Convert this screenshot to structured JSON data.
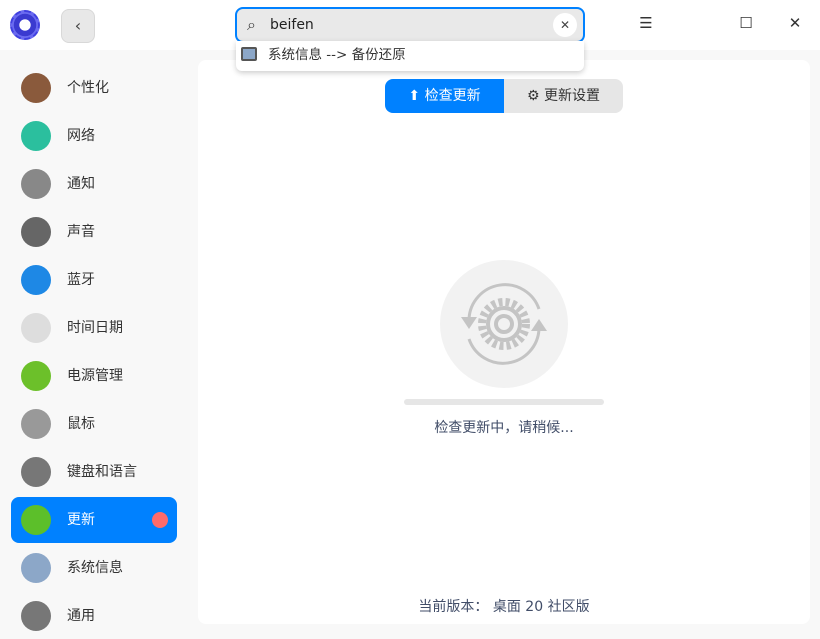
{
  "search": {
    "value": "beifen",
    "suggestion": "系统信息 --> 备份还原"
  },
  "sidebar": {
    "items": [
      {
        "label": "个性化",
        "color": "#8a5a3c"
      },
      {
        "label": "网络",
        "color": "#2bbf9e"
      },
      {
        "label": "通知",
        "color": "#888888"
      },
      {
        "label": "声音",
        "color": "#666666"
      },
      {
        "label": "蓝牙",
        "color": "#1e88e5"
      },
      {
        "label": "时间日期",
        "color": "#dddddd"
      },
      {
        "label": "电源管理",
        "color": "#6cc02a"
      },
      {
        "label": "鼠标",
        "color": "#999999"
      },
      {
        "label": "键盘和语言",
        "color": "#777777"
      },
      {
        "label": "更新",
        "color": "#5cbf2a"
      },
      {
        "label": "系统信息",
        "color": "#8ca7c8"
      },
      {
        "label": "通用",
        "color": "#777777"
      }
    ]
  },
  "main": {
    "tabs": [
      "检查更新",
      "更新设置"
    ],
    "status": "检查更新中，请稍候...",
    "progress": 0,
    "version": "当前版本：  桌面 20 社区版"
  },
  "accent": "#0081ff"
}
